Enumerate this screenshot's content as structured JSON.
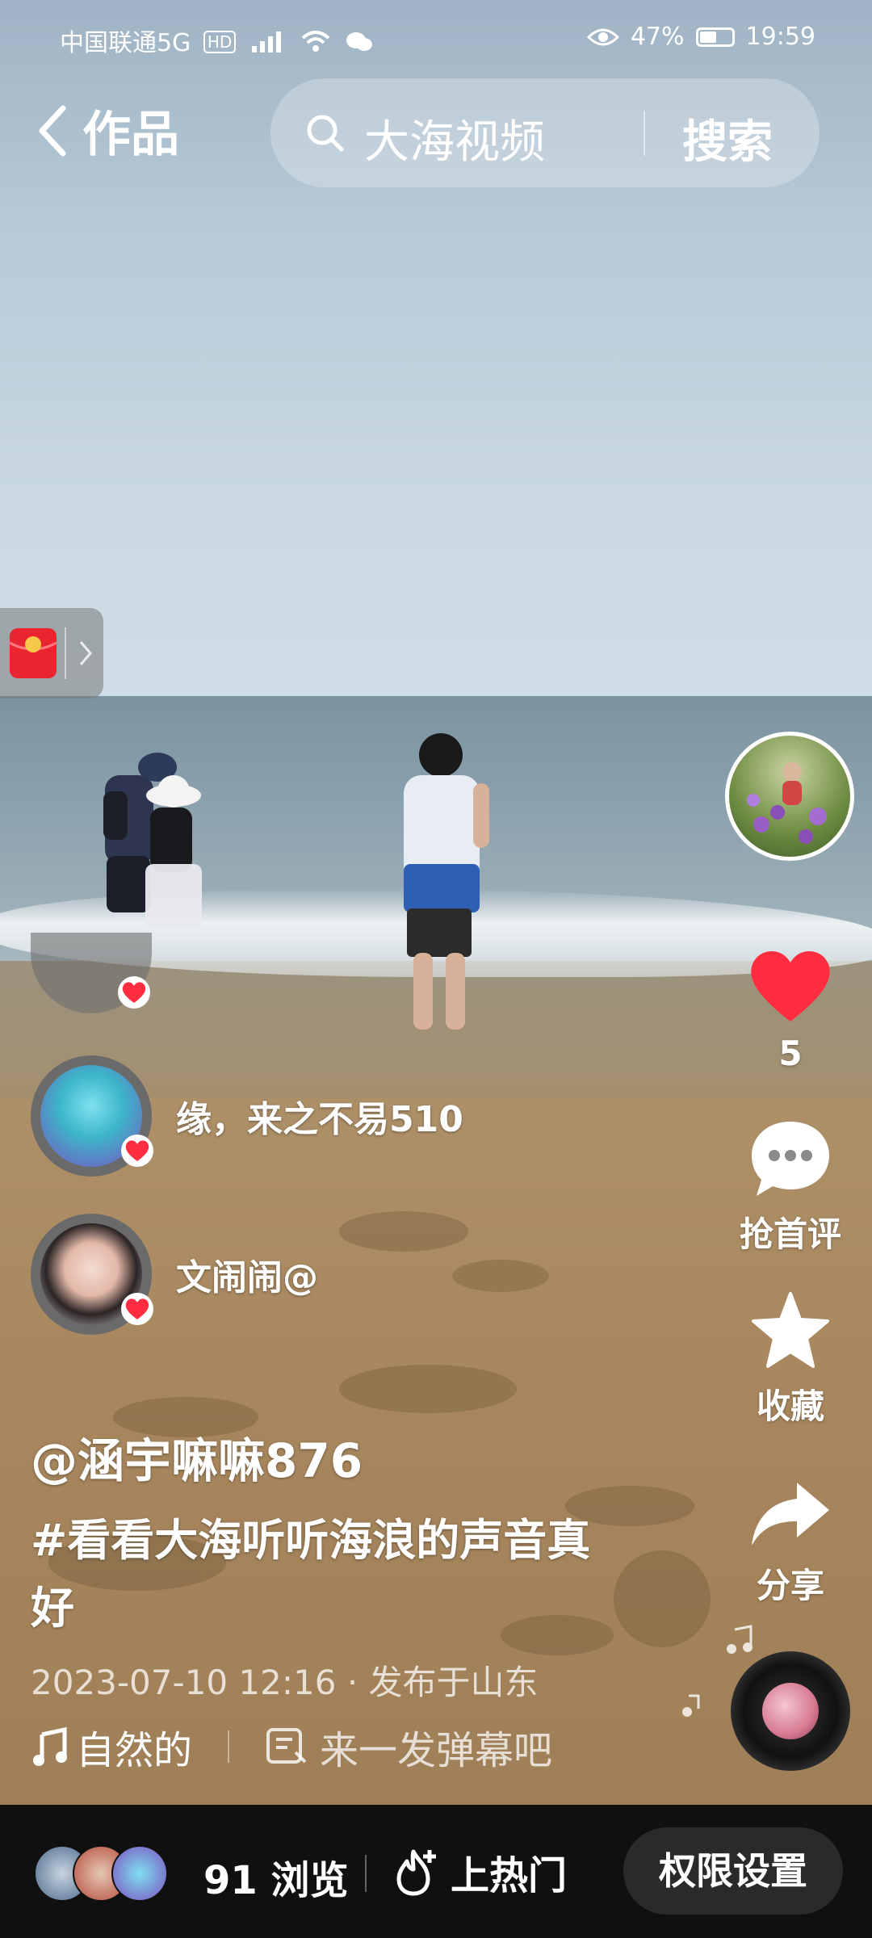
{
  "status_bar": {
    "carrier": "中国联通5G",
    "network_badge": "HD",
    "battery": "47%",
    "time": "19:59"
  },
  "top_bar": {
    "title": "作品",
    "search_query": "大海视频",
    "search_button": "搜索"
  },
  "actions": {
    "like_count": "5",
    "comment_label": "抢首评",
    "favorite_label": "收藏",
    "share_label": "分享"
  },
  "likers": [
    {
      "name": "缘，来之不易510"
    },
    {
      "name": "文闹闹@"
    }
  ],
  "post": {
    "author": "@涵宇嘛嘛876",
    "description": "#看看大海听听海浪的声音真好",
    "meta": "2023-07-10 12:16 · 发布于山东",
    "music": "自然的",
    "danmaku_prompt": "来一发弹幕吧"
  },
  "bottom_bar": {
    "views": "91 浏览",
    "hot_label": "上热门",
    "permission_button": "权限设置"
  },
  "colors": {
    "like_red": "#ff2d3f",
    "bottom_bg": "#101010"
  }
}
